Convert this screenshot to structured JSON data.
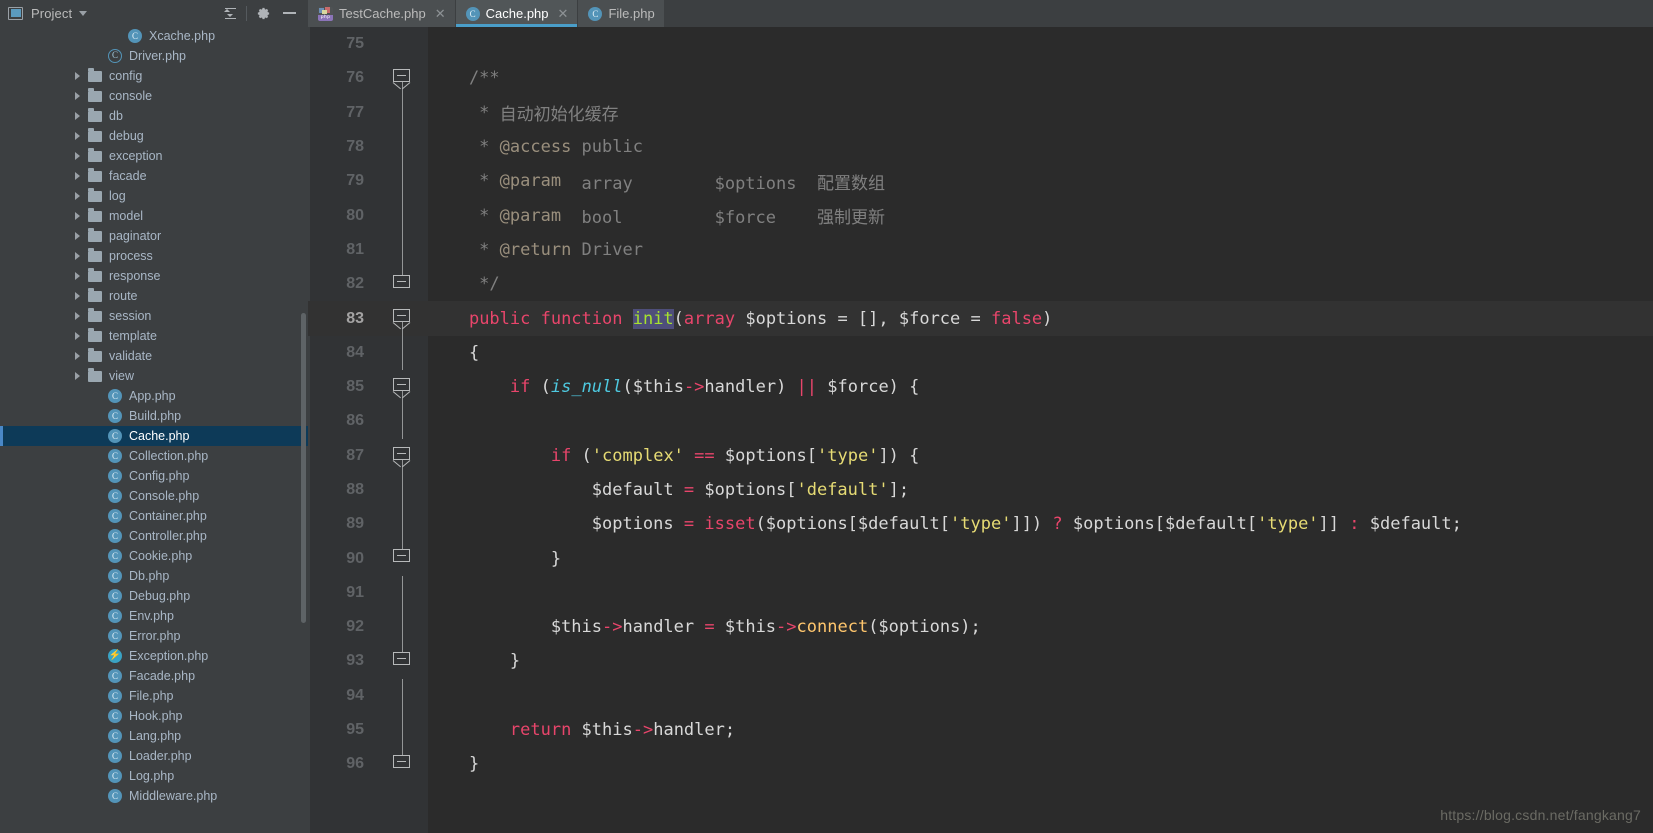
{
  "sidebar": {
    "title": "Project",
    "icons": [
      "project-icon",
      "chevron-down-icon",
      "collapse-all-icon",
      "gear-icon",
      "minimize-icon"
    ],
    "tree": [
      {
        "label": "Xcache.php",
        "kind": "class",
        "indent": 3,
        "expandable": false,
        "selected": false
      },
      {
        "label": "Driver.php",
        "kind": "abstract",
        "indent": 2,
        "expandable": false,
        "selected": false
      },
      {
        "label": "config",
        "kind": "folder",
        "indent": 1,
        "expandable": true,
        "selected": false
      },
      {
        "label": "console",
        "kind": "folder",
        "indent": 1,
        "expandable": true,
        "selected": false
      },
      {
        "label": "db",
        "kind": "folder",
        "indent": 1,
        "expandable": true,
        "selected": false
      },
      {
        "label": "debug",
        "kind": "folder",
        "indent": 1,
        "expandable": true,
        "selected": false
      },
      {
        "label": "exception",
        "kind": "folder",
        "indent": 1,
        "expandable": true,
        "selected": false
      },
      {
        "label": "facade",
        "kind": "folder",
        "indent": 1,
        "expandable": true,
        "selected": false
      },
      {
        "label": "log",
        "kind": "folder",
        "indent": 1,
        "expandable": true,
        "selected": false
      },
      {
        "label": "model",
        "kind": "folder",
        "indent": 1,
        "expandable": true,
        "selected": false
      },
      {
        "label": "paginator",
        "kind": "folder",
        "indent": 1,
        "expandable": true,
        "selected": false
      },
      {
        "label": "process",
        "kind": "folder",
        "indent": 1,
        "expandable": true,
        "selected": false
      },
      {
        "label": "response",
        "kind": "folder",
        "indent": 1,
        "expandable": true,
        "selected": false
      },
      {
        "label": "route",
        "kind": "folder",
        "indent": 1,
        "expandable": true,
        "selected": false
      },
      {
        "label": "session",
        "kind": "folder",
        "indent": 1,
        "expandable": true,
        "selected": false
      },
      {
        "label": "template",
        "kind": "folder",
        "indent": 1,
        "expandable": true,
        "selected": false
      },
      {
        "label": "validate",
        "kind": "folder",
        "indent": 1,
        "expandable": true,
        "selected": false
      },
      {
        "label": "view",
        "kind": "folder",
        "indent": 1,
        "expandable": true,
        "selected": false
      },
      {
        "label": "App.php",
        "kind": "class",
        "indent": 2,
        "expandable": false,
        "selected": false
      },
      {
        "label": "Build.php",
        "kind": "class",
        "indent": 2,
        "expandable": false,
        "selected": false
      },
      {
        "label": "Cache.php",
        "kind": "class",
        "indent": 2,
        "expandable": false,
        "selected": true
      },
      {
        "label": "Collection.php",
        "kind": "class",
        "indent": 2,
        "expandable": false,
        "selected": false
      },
      {
        "label": "Config.php",
        "kind": "class",
        "indent": 2,
        "expandable": false,
        "selected": false
      },
      {
        "label": "Console.php",
        "kind": "class",
        "indent": 2,
        "expandable": false,
        "selected": false
      },
      {
        "label": "Container.php",
        "kind": "class",
        "indent": 2,
        "expandable": false,
        "selected": false
      },
      {
        "label": "Controller.php",
        "kind": "class",
        "indent": 2,
        "expandable": false,
        "selected": false
      },
      {
        "label": "Cookie.php",
        "kind": "class",
        "indent": 2,
        "expandable": false,
        "selected": false
      },
      {
        "label": "Db.php",
        "kind": "class",
        "indent": 2,
        "expandable": false,
        "selected": false
      },
      {
        "label": "Debug.php",
        "kind": "class",
        "indent": 2,
        "expandable": false,
        "selected": false
      },
      {
        "label": "Env.php",
        "kind": "class",
        "indent": 2,
        "expandable": false,
        "selected": false
      },
      {
        "label": "Error.php",
        "kind": "class",
        "indent": 2,
        "expandable": false,
        "selected": false
      },
      {
        "label": "Exception.php",
        "kind": "exception",
        "indent": 2,
        "expandable": false,
        "selected": false
      },
      {
        "label": "Facade.php",
        "kind": "class",
        "indent": 2,
        "expandable": false,
        "selected": false
      },
      {
        "label": "File.php",
        "kind": "class",
        "indent": 2,
        "expandable": false,
        "selected": false
      },
      {
        "label": "Hook.php",
        "kind": "class",
        "indent": 2,
        "expandable": false,
        "selected": false
      },
      {
        "label": "Lang.php",
        "kind": "class",
        "indent": 2,
        "expandable": false,
        "selected": false
      },
      {
        "label": "Loader.php",
        "kind": "class",
        "indent": 2,
        "expandable": false,
        "selected": false
      },
      {
        "label": "Log.php",
        "kind": "class",
        "indent": 2,
        "expandable": false,
        "selected": false
      },
      {
        "label": "Middleware.php",
        "kind": "class",
        "indent": 2,
        "expandable": false,
        "selected": false
      }
    ]
  },
  "tabs": [
    {
      "label": "TestCache.php",
      "icon": "php-file-icon",
      "active": false,
      "closable": true
    },
    {
      "label": "Cache.php",
      "icon": "php-class-icon",
      "active": true,
      "closable": true
    },
    {
      "label": "File.php",
      "icon": "php-class-icon",
      "active": false,
      "closable": false
    }
  ],
  "editor": {
    "first_line": 75,
    "current_line": 83,
    "search_match": "init",
    "lines": [
      {
        "num": 75,
        "fold": "none",
        "tokens": []
      },
      {
        "num": 76,
        "fold": "start",
        "tokens": [
          {
            "t": "    /**",
            "c": "c-com"
          }
        ]
      },
      {
        "num": 77,
        "fold": "body",
        "tokens": [
          {
            "t": "     * ",
            "c": "c-com"
          },
          {
            "t": "自动初始化缓存",
            "c": "c-com"
          }
        ]
      },
      {
        "num": 78,
        "fold": "body",
        "tokens": [
          {
            "t": "     * ",
            "c": "c-com"
          },
          {
            "t": "@access",
            "c": "c-doctag"
          },
          {
            "t": " public",
            "c": "c-com"
          }
        ]
      },
      {
        "num": 79,
        "fold": "body",
        "tokens": [
          {
            "t": "     * ",
            "c": "c-com"
          },
          {
            "t": "@param",
            "c": "c-doctag"
          },
          {
            "t": "  array        $options  配置数组",
            "c": "c-com"
          }
        ]
      },
      {
        "num": 80,
        "fold": "body",
        "tokens": [
          {
            "t": "     * ",
            "c": "c-com"
          },
          {
            "t": "@param",
            "c": "c-doctag"
          },
          {
            "t": "  bool         $force    强制更新",
            "c": "c-com"
          }
        ]
      },
      {
        "num": 81,
        "fold": "body",
        "tokens": [
          {
            "t": "     * ",
            "c": "c-com"
          },
          {
            "t": "@return",
            "c": "c-doctag"
          },
          {
            "t": " Driver",
            "c": "c-com"
          }
        ]
      },
      {
        "num": 82,
        "fold": "end",
        "tokens": [
          {
            "t": "     */",
            "c": "c-com"
          }
        ]
      },
      {
        "num": 83,
        "fold": "start",
        "tokens": [
          {
            "t": "    ",
            "c": "c-txt"
          },
          {
            "t": "public function ",
            "c": "c-kw"
          },
          {
            "t": "init",
            "c": "c-green",
            "hl": true
          },
          {
            "t": "(",
            "c": "c-txt"
          },
          {
            "t": "array",
            "c": "c-kw"
          },
          {
            "t": " $options = [], $force = ",
            "c": "c-txt"
          },
          {
            "t": "false",
            "c": "c-kw"
          },
          {
            "t": ")",
            "c": "c-txt"
          }
        ]
      },
      {
        "num": 84,
        "fold": "body",
        "tokens": [
          {
            "t": "    {",
            "c": "c-txt"
          }
        ]
      },
      {
        "num": 85,
        "fold": "start",
        "tokens": [
          {
            "t": "        ",
            "c": "c-txt"
          },
          {
            "t": "if",
            "c": "c-kw"
          },
          {
            "t": " (",
            "c": "c-txt"
          },
          {
            "t": "is_null",
            "c": "c-built"
          },
          {
            "t": "($this",
            "c": "c-txt"
          },
          {
            "t": "->",
            "c": "c-arrow"
          },
          {
            "t": "handler) ",
            "c": "c-txt"
          },
          {
            "t": "||",
            "c": "c-kw"
          },
          {
            "t": " $force) {",
            "c": "c-txt"
          }
        ]
      },
      {
        "num": 86,
        "fold": "body",
        "tokens": []
      },
      {
        "num": 87,
        "fold": "start",
        "tokens": [
          {
            "t": "            ",
            "c": "c-txt"
          },
          {
            "t": "if",
            "c": "c-kw"
          },
          {
            "t": " (",
            "c": "c-txt"
          },
          {
            "t": "'complex'",
            "c": "c-str"
          },
          {
            "t": " ",
            "c": "c-txt"
          },
          {
            "t": "==",
            "c": "c-kw"
          },
          {
            "t": " $options[",
            "c": "c-txt"
          },
          {
            "t": "'type'",
            "c": "c-str"
          },
          {
            "t": "]) {",
            "c": "c-txt"
          }
        ]
      },
      {
        "num": 88,
        "fold": "body",
        "tokens": [
          {
            "t": "                $default ",
            "c": "c-txt"
          },
          {
            "t": "=",
            "c": "c-kw"
          },
          {
            "t": " $options[",
            "c": "c-txt"
          },
          {
            "t": "'default'",
            "c": "c-str"
          },
          {
            "t": "];",
            "c": "c-txt"
          }
        ]
      },
      {
        "num": 89,
        "fold": "body",
        "tokens": [
          {
            "t": "                $options ",
            "c": "c-txt"
          },
          {
            "t": "=",
            "c": "c-kw"
          },
          {
            "t": " ",
            "c": "c-txt"
          },
          {
            "t": "isset",
            "c": "c-kw"
          },
          {
            "t": "($options[$default[",
            "c": "c-txt"
          },
          {
            "t": "'type'",
            "c": "c-str"
          },
          {
            "t": "]]) ",
            "c": "c-txt"
          },
          {
            "t": "?",
            "c": "c-kw"
          },
          {
            "t": " $options[$default[",
            "c": "c-txt"
          },
          {
            "t": "'type'",
            "c": "c-str"
          },
          {
            "t": "]] ",
            "c": "c-txt"
          },
          {
            "t": ":",
            "c": "c-kw"
          },
          {
            "t": " $default;",
            "c": "c-txt"
          }
        ]
      },
      {
        "num": 90,
        "fold": "end",
        "tokens": [
          {
            "t": "            }",
            "c": "c-txt"
          }
        ]
      },
      {
        "num": 91,
        "fold": "body",
        "tokens": []
      },
      {
        "num": 92,
        "fold": "body",
        "tokens": [
          {
            "t": "            $this",
            "c": "c-txt"
          },
          {
            "t": "->",
            "c": "c-arrow"
          },
          {
            "t": "handler ",
            "c": "c-txt"
          },
          {
            "t": "=",
            "c": "c-kw"
          },
          {
            "t": " $this",
            "c": "c-txt"
          },
          {
            "t": "->",
            "c": "c-arrow"
          },
          {
            "t": "connect",
            "c": "c-fn"
          },
          {
            "t": "($options);",
            "c": "c-txt"
          }
        ]
      },
      {
        "num": 93,
        "fold": "end",
        "tokens": [
          {
            "t": "        }",
            "c": "c-txt"
          }
        ]
      },
      {
        "num": 94,
        "fold": "body",
        "tokens": []
      },
      {
        "num": 95,
        "fold": "body",
        "tokens": [
          {
            "t": "        ",
            "c": "c-txt"
          },
          {
            "t": "return",
            "c": "c-kw"
          },
          {
            "t": " $this",
            "c": "c-txt"
          },
          {
            "t": "->",
            "c": "c-arrow"
          },
          {
            "t": "handler;",
            "c": "c-txt"
          }
        ]
      },
      {
        "num": 96,
        "fold": "end",
        "tokens": [
          {
            "t": "    }",
            "c": "c-txt"
          }
        ]
      }
    ]
  },
  "watermark": "https://blog.csdn.net/fangkang7",
  "colors": {
    "sidebar_bg": "#3c3f41",
    "editor_bg": "#2b2b2b",
    "gutter_bg": "#313335",
    "selection_bg": "#0d3a58",
    "tab_active_underline": "#4a9ec9",
    "current_line_bg": "#323232",
    "keyword": "#e8456b",
    "string": "#e6db74",
    "comment": "#808080"
  }
}
